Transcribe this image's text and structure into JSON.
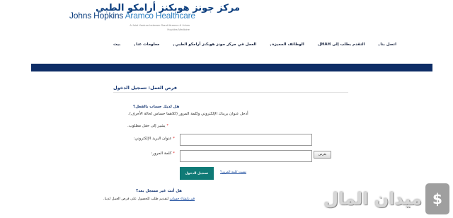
{
  "brand": {
    "logo_arabic": "مركز جونز هوبكنز أرامكو الطبي",
    "logo_english_part1": "Johns Hopkins ",
    "logo_english_part2": "Aramco Healthcare",
    "tagline": "A Joint Venture between Saudi Aramco & Johns Hopkins Medicine"
  },
  "nav": {
    "items": [
      "اتصل بنا",
      "JHAH التقدم بطلب إلى",
      "الوظائف المميزة",
      "العمل في مركز جونز هوبكنز أرامكو الطبي",
      "معلومات عنا",
      "بيت"
    ]
  },
  "page": {
    "title": "فرص العمل: تسجيل الدخول"
  },
  "login": {
    "existing_account_question": "هل لديك حساب بالفعل؟",
    "hint": "أدخل عنوان بريدك الإلكتروني وكلمة المرور (كلاهما حساس لحالة الأحرف).",
    "required_note": "يشير إلى حقل مطلوب.",
    "required_star": "*",
    "email_label": "عنوان البريد الإلكتروني:",
    "email_value": "",
    "password_label": "كلمة المرور:",
    "password_value": "",
    "show_button": "يعرض",
    "login_button": "تسجيل الدخول",
    "forgot_link": "نسيت كلمة المرور؟"
  },
  "register": {
    "question": "هل أنت غير مسجل بعد؟",
    "link_text": "قم بإنشاء حساب",
    "rest_text": " لتقديم طلب للحصول على فرص العمل لدينا."
  },
  "watermark": {
    "text": "ميدان المال",
    "icon_glyph": "$"
  },
  "colors": {
    "brand_blue": "#0d3f7f",
    "band": "#0e2d66",
    "login_button": "#0f7a76",
    "link": "#1f4fa0"
  }
}
